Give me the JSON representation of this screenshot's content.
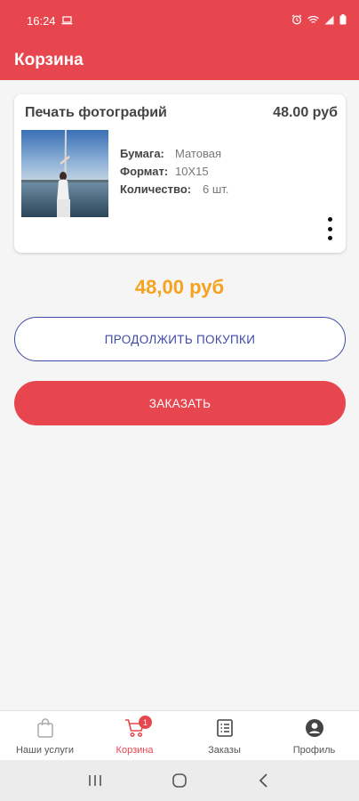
{
  "status": {
    "time": "16:24"
  },
  "header": {
    "title": "Корзина"
  },
  "cart_item": {
    "name": "Печать фотографий",
    "price": "48.00 руб",
    "props": [
      {
        "label": "Бумага:",
        "value": "Матовая"
      },
      {
        "label": "Формат:",
        "value": "10X15"
      },
      {
        "label": "Количество:",
        "value": "6 шт."
      }
    ]
  },
  "total": "48,00 руб",
  "buttons": {
    "continue": "ПРОДОЛЖИТЬ ПОКУПКИ",
    "order": "ЗАКАЗАТЬ"
  },
  "nav": {
    "items": [
      {
        "label": "Наши услуги",
        "icon": "bag-icon"
      },
      {
        "label": "Корзина",
        "icon": "cart-icon",
        "badge": "1"
      },
      {
        "label": "Заказы",
        "icon": "orders-icon"
      },
      {
        "label": "Профиль",
        "icon": "profile-icon"
      }
    ]
  },
  "colors": {
    "primary": "#e8464f",
    "total": "#f5a21e",
    "outline": "#3f4aa8"
  }
}
